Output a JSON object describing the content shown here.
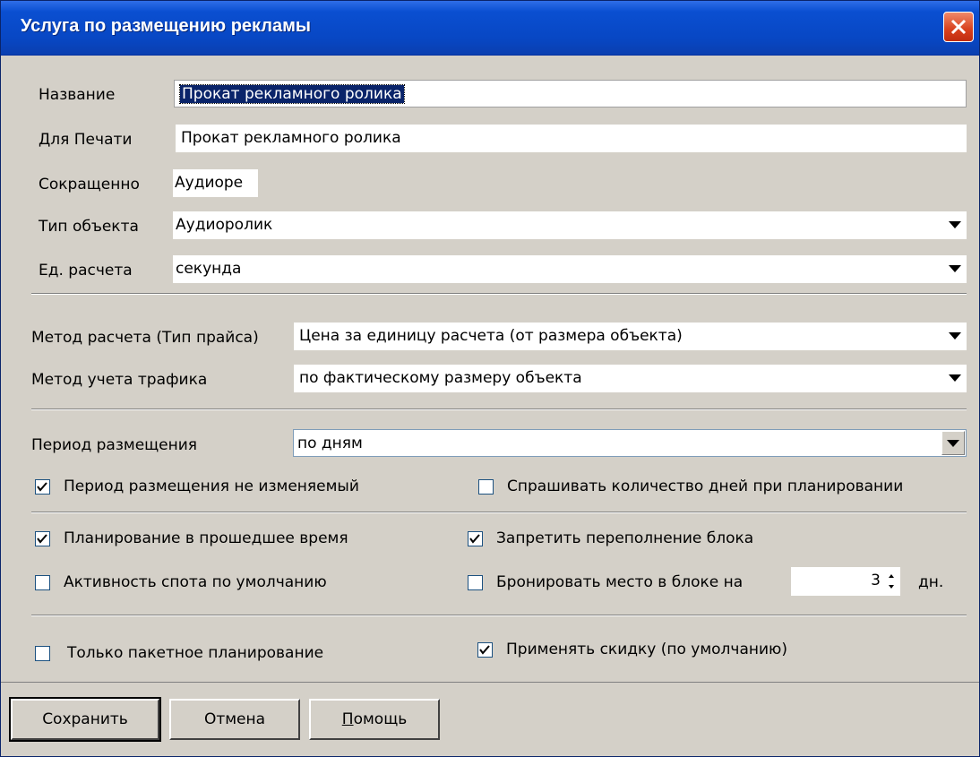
{
  "window": {
    "title": "Услуга по размещению рекламы"
  },
  "fields": {
    "name": {
      "label": "Название",
      "value": "Прокат рекламного ролика"
    },
    "print": {
      "label": "Для Печати",
      "value": "Прокат рекламного ролика"
    },
    "short": {
      "label": "Сокращенно",
      "value": "Аудиоре"
    },
    "object_type": {
      "label": "Тип объекта",
      "value": "Аудиоролик"
    },
    "unit": {
      "label": "Ед. расчета",
      "value": "секунда"
    },
    "price_method": {
      "label": "Метод расчета (Тип прайса)",
      "value": "Цена за единицу расчета (от размера объекта)"
    },
    "traffic_method": {
      "label": "Метод учета трафика",
      "value": "по фактическому размеру объекта"
    },
    "period": {
      "label": "Период размещения",
      "value": "по дням"
    }
  },
  "checkboxes": {
    "period_fixed": {
      "label": "Период размещения не изменяемый",
      "checked": true
    },
    "ask_days": {
      "label": "Спрашивать количество дней при планировании",
      "checked": false
    },
    "past_planning": {
      "label": "Планирование в прошедшее время",
      "checked": true
    },
    "block_overflow": {
      "label": "Запретить переполнение блока",
      "checked": true
    },
    "spot_active": {
      "label": "Активность спота по умолчанию",
      "checked": false
    },
    "reserve": {
      "label": "Бронировать место в блоке на",
      "checked": false
    },
    "package_only": {
      "label": "Только пакетное планирование",
      "checked": false
    },
    "discount": {
      "label": "Применять скидку (по умолчанию)",
      "checked": true
    }
  },
  "reserve_days": {
    "value": "3",
    "unit": "дн."
  },
  "buttons": {
    "save": "Сохранить",
    "cancel": "Отмена",
    "help_first": "П",
    "help_rest": "омощь"
  }
}
